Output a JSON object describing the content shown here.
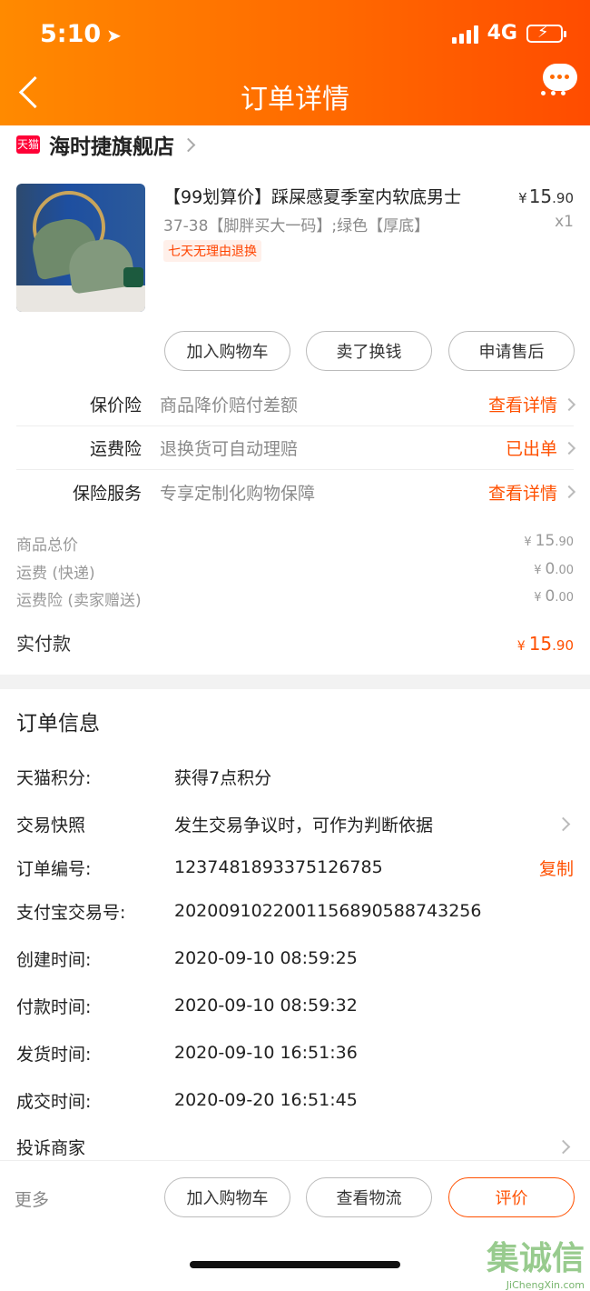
{
  "status_bar": {
    "time": "5:10",
    "network": "4G"
  },
  "header": {
    "title": "订单详情"
  },
  "shop": {
    "name": "海时捷旗舰店",
    "logo_text": "天猫"
  },
  "product": {
    "title": "【99划算价】踩屎感夏季室内软底男士",
    "spec": "37-38【脚胖买大一码】;绿色【厚底】",
    "badge": "七天无理由退换",
    "price_yen": "¥",
    "price_int": "15",
    "price_dec": ".90",
    "qty": "x1"
  },
  "product_buttons": [
    "加入购物车",
    "卖了换钱",
    "申请售后"
  ],
  "insurance": [
    {
      "label": "保价险",
      "desc": "商品降价赔付差额",
      "action": "查看详情"
    },
    {
      "label": "运费险",
      "desc": "退换货可自动理赔",
      "action": "已出单"
    },
    {
      "label": "保险服务",
      "desc": "专享定制化购物保障",
      "action": "查看详情"
    }
  ],
  "costs": [
    {
      "label": "商品总价",
      "int": "15",
      "dec": ".90"
    },
    {
      "label": "运费 (快递)",
      "int": "0",
      "dec": ".00"
    },
    {
      "label": "运费险 (卖家赠送)",
      "int": "0",
      "dec": ".00"
    }
  ],
  "total": {
    "label": "实付款",
    "int": "15",
    "dec": ".90"
  },
  "order_info": {
    "title": "订单信息",
    "rows": [
      {
        "label": "天猫积分:",
        "value": "获得7点积分"
      },
      {
        "label": "交易快照",
        "value": "发生交易争议时，可作为判断依据"
      },
      {
        "label": "订单编号:",
        "value": "1237481893375126785",
        "action": "复制"
      },
      {
        "label": "支付宝交易号:",
        "value": "2020091022001156890588743256"
      },
      {
        "label": "创建时间:",
        "value": "2020-09-10 08:59:25"
      },
      {
        "label": "付款时间:",
        "value": "2020-09-10 08:59:32"
      },
      {
        "label": "发货时间:",
        "value": "2020-09-10 16:51:36"
      },
      {
        "label": "成交时间:",
        "value": "2020-09-20 16:51:45"
      },
      {
        "label": "投诉商家",
        "value": ""
      }
    ]
  },
  "bottom_bar": {
    "more": "更多",
    "buttons": [
      "加入购物车",
      "查看物流",
      "评价"
    ]
  },
  "watermark": {
    "text": "集诚信",
    "sub": "JiChengXin.com"
  },
  "colors": {
    "accent": "#ff5000",
    "header_start": "#ff8a00",
    "header_end": "#ff4c00"
  }
}
